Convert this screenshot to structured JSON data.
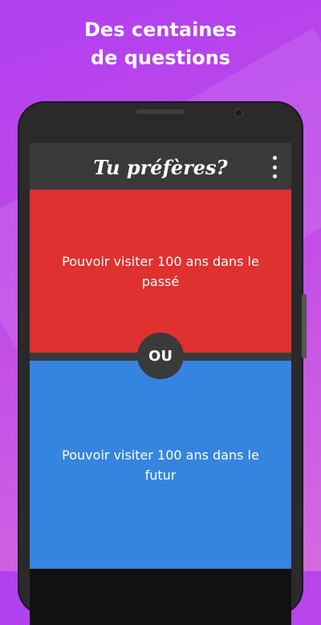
{
  "headline": {
    "line1": "Des centaines",
    "line2": "de questions"
  },
  "app": {
    "title": "Tu préfères?",
    "menu_icon": "more-vertical-icon",
    "option_a": {
      "text": "Pouvoir visiter 100 ans dans le passé",
      "color": "#e03131"
    },
    "option_b": {
      "text": "Pouvoir visiter 100 ans dans le futur",
      "color": "#3585e0"
    },
    "or_label": "OU"
  },
  "colors": {
    "background": "#c04ae8",
    "bar": "#3a3a3a"
  }
}
